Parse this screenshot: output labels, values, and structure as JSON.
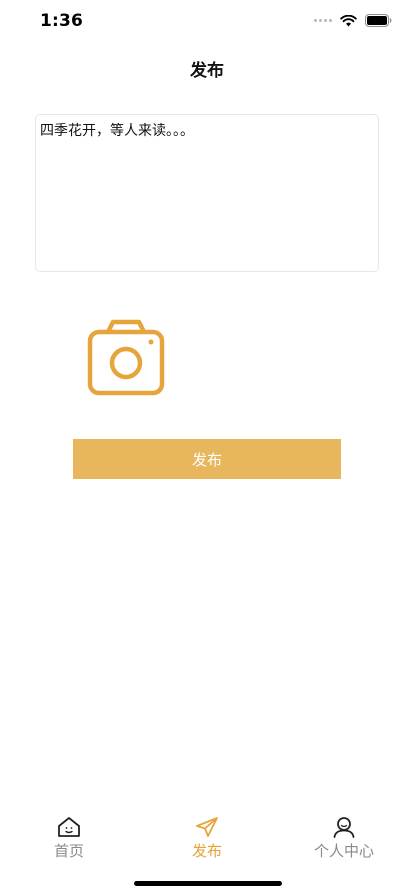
{
  "status_bar": {
    "time": "1:36"
  },
  "nav": {
    "title": "发布"
  },
  "composer": {
    "text": "四季花开，等人来读。。。"
  },
  "publish_button_label": "发布",
  "tab_bar": {
    "items": [
      {
        "label": "首页",
        "icon": "home-icon",
        "active": false
      },
      {
        "label": "发布",
        "icon": "send-icon",
        "active": true
      },
      {
        "label": "个人中心",
        "icon": "person-icon",
        "active": false
      }
    ]
  },
  "colors": {
    "accent": "#e8b65d",
    "accent_icon": "#e6a53c",
    "inactive": "#8a8a8a"
  }
}
